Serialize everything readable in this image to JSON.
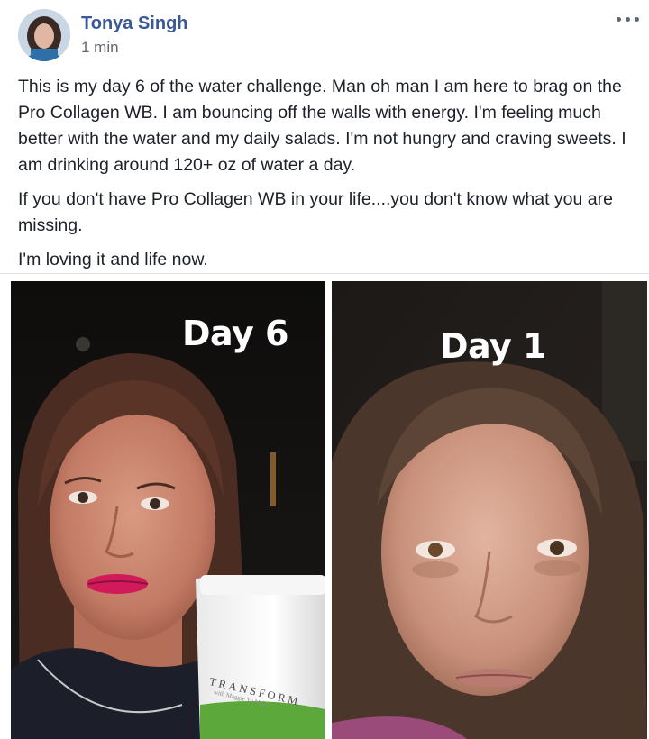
{
  "post": {
    "author": "Tonya Singh",
    "time": "1 min",
    "more_icon": "more-horizontal-icon",
    "paragraphs": [
      "This is my day 6 of the water challenge. Man oh man I am here to brag on the Pro Collagen WB. I am bouncing off the walls with energy. I'm feeling much better with the water and my daily salads. I'm not hungry and craving sweets. I am drinking around 120+ oz of water a day.",
      "If you don't have Pro Collagen WB in your life....you don't know what you are missing.",
      "I'm loving it and life now."
    ]
  },
  "photos": {
    "left": {
      "caption": "Day 6",
      "jar_brand": "TRANSFORM",
      "jar_sub": "with Maggie Yu M.D"
    },
    "right": {
      "caption": "Day 1"
    }
  },
  "colors": {
    "author_link": "#385898",
    "text": "#1d2129",
    "secondary_text": "#616770",
    "divider": "#dddfe2"
  }
}
